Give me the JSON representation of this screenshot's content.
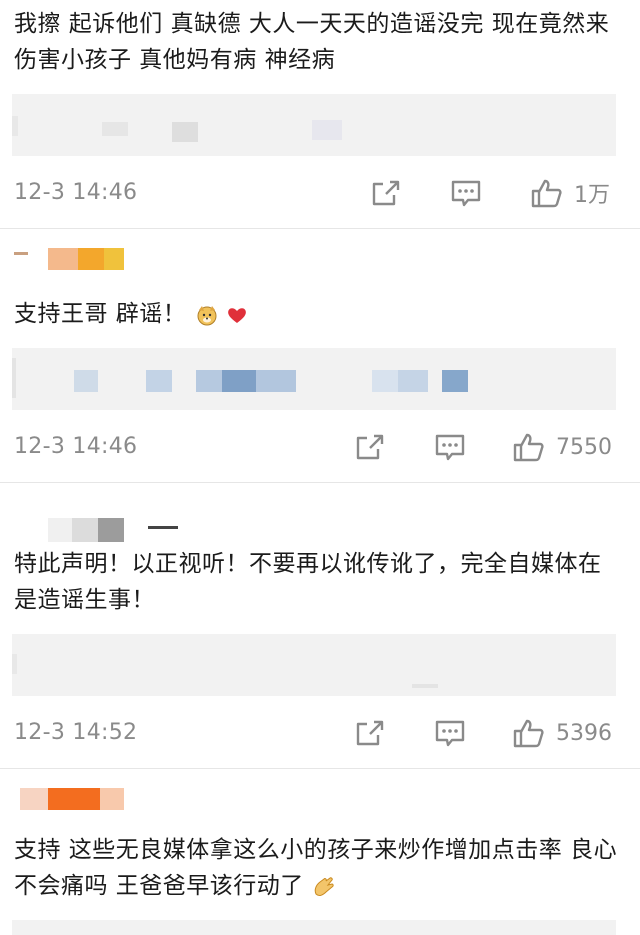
{
  "comments": [
    {
      "text": "我擦 起诉他们 真缺德 大人一天天的造谣没完 现在竟然来伤害小孩子 真他妈有病 神经病",
      "time": "12-3 14:46",
      "likes": "1万"
    },
    {
      "text": "支持王哥 辟谣！",
      "emoji": [
        "dog-face",
        "red-heart"
      ],
      "time": "12-3 14:46",
      "likes": "7550"
    },
    {
      "text": "特此声明！以正视听！不要再以讹传讹了，完全自媒体在是造谣生事！",
      "time": "12-3 14:52",
      "likes": "5396"
    },
    {
      "text": "支持 这些无良媒体拿这么小的孩子来炒作增加点击率 良心不会痛吗 王爸爸早该行动了",
      "emoji": [
        "clapping-hands"
      ],
      "time": "",
      "likes": ""
    }
  ],
  "icons": {
    "share": "share-icon",
    "comment": "comment-icon",
    "like": "thumbs-up-icon"
  },
  "colors": {
    "meta_gray": "#8a8a8a",
    "quote_bg": "#f2f2f2",
    "divider": "#e6e6e6",
    "heart": "#e0303a"
  }
}
